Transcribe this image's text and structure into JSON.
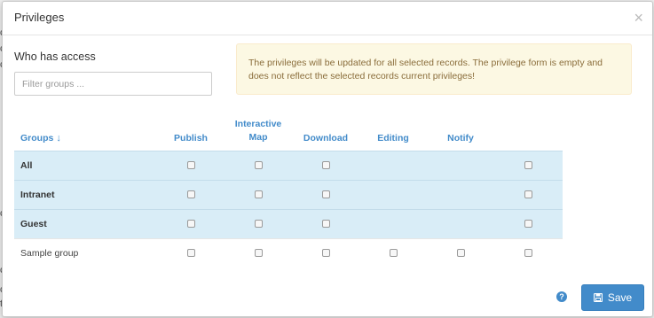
{
  "modal": {
    "title": "Privileges",
    "close_symbol": "×"
  },
  "access": {
    "label": "Who has access",
    "filter_placeholder": "Filter groups ..."
  },
  "alert": {
    "text": "The privileges will be updated for all selected records. The privilege form is empty and does not reflect the selected records current privileges!"
  },
  "table": {
    "group_header": "Groups",
    "sort_icon": "arrow-down-icon",
    "columns": [
      "Publish",
      "Interactive Map",
      "Download",
      "Editing",
      "Notify",
      ""
    ],
    "rows": [
      {
        "name": "All",
        "selected": true,
        "boxes": [
          true,
          true,
          true,
          false,
          false,
          true
        ]
      },
      {
        "name": "Intranet",
        "selected": true,
        "boxes": [
          true,
          true,
          true,
          false,
          false,
          true
        ]
      },
      {
        "name": "Guest",
        "selected": true,
        "boxes": [
          true,
          true,
          true,
          false,
          false,
          true
        ]
      },
      {
        "name": "Sample group",
        "selected": false,
        "boxes": [
          true,
          true,
          true,
          true,
          true,
          true
        ]
      }
    ]
  },
  "footer": {
    "help_icon": "question-circle-icon",
    "save_icon": "floppy-disk-icon",
    "save_label": "Save"
  },
  "colors": {
    "primary": "#428bca",
    "selected_row": "#d9edf7",
    "warning_bg": "#fcf8e3",
    "warning_text": "#8a6d3b"
  }
}
